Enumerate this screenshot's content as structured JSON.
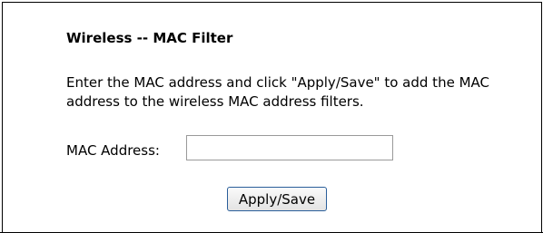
{
  "page": {
    "title": "Wireless -- MAC Filter",
    "description": "Enter the MAC address and click \"Apply/Save\" to add the MAC address to the wireless MAC address filters.",
    "mac_label": "MAC Address:",
    "mac_value": "",
    "apply_label": "Apply/Save"
  }
}
